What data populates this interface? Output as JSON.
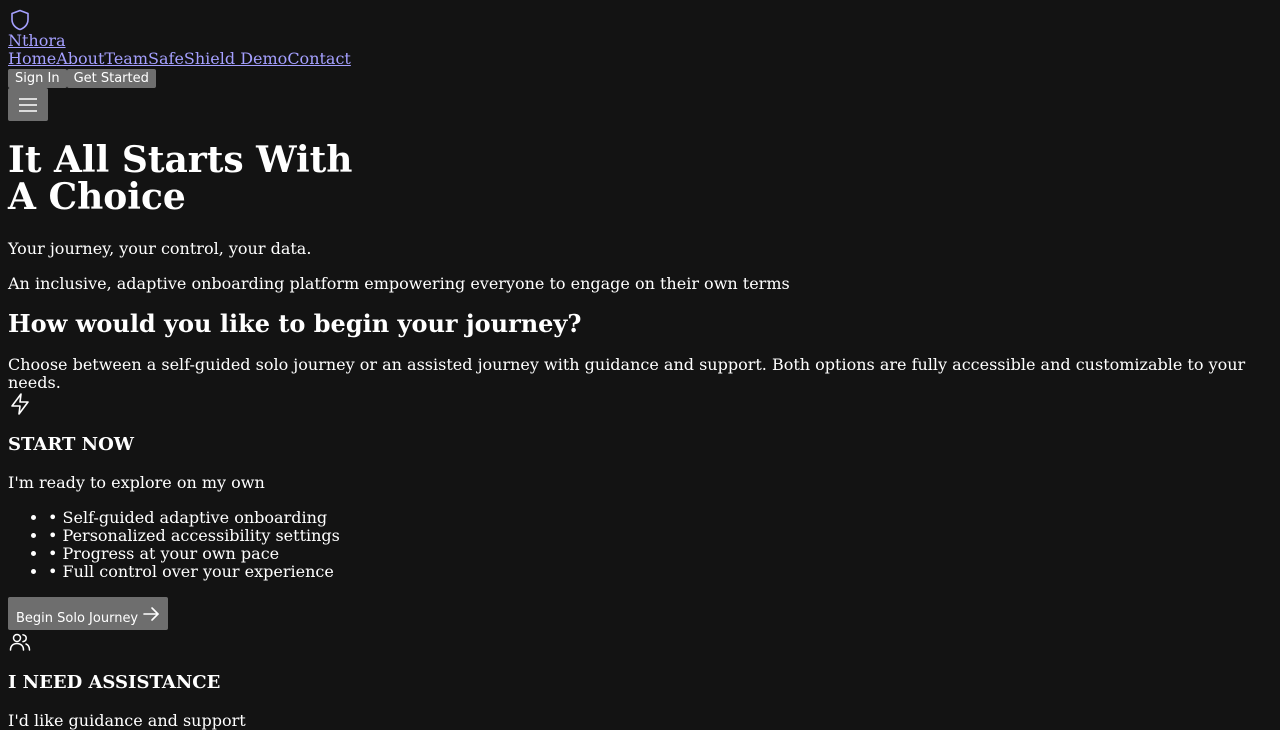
{
  "header": {
    "brand": "Nthora",
    "nav": [
      "Home",
      "About",
      "Team",
      "SafeShield Demo",
      "Contact"
    ],
    "sign_in": "Sign In",
    "get_started": "Get Started"
  },
  "hero": {
    "title_line1": "It All Starts With",
    "title_line2": "A Choice",
    "tagline": "Your journey, your control, your data.",
    "description": "An inclusive, adaptive onboarding platform empowering everyone to engage on their own terms"
  },
  "choice": {
    "heading": "How would you like to begin your journey?",
    "intro": "Choose between a self-guided solo journey or an assisted journey with guidance and support. Both options are fully accessible and customizable to your needs."
  },
  "solo": {
    "icon": "lightning-icon",
    "title": "START NOW",
    "description": "I'm ready to explore on my own",
    "features": [
      "• Self-guided adaptive onboarding",
      "• Personalized accessibility settings",
      "• Progress at your own pace",
      "• Full control over your experience"
    ],
    "cta": "Begin Solo Journey"
  },
  "assisted": {
    "icon": "users-icon",
    "title": "I NEED ASSISTANCE",
    "description": "I'd like guidance and support"
  },
  "colors": {
    "background": "#131313",
    "link": "#a5a0ff",
    "button": "#6e6e6e"
  }
}
